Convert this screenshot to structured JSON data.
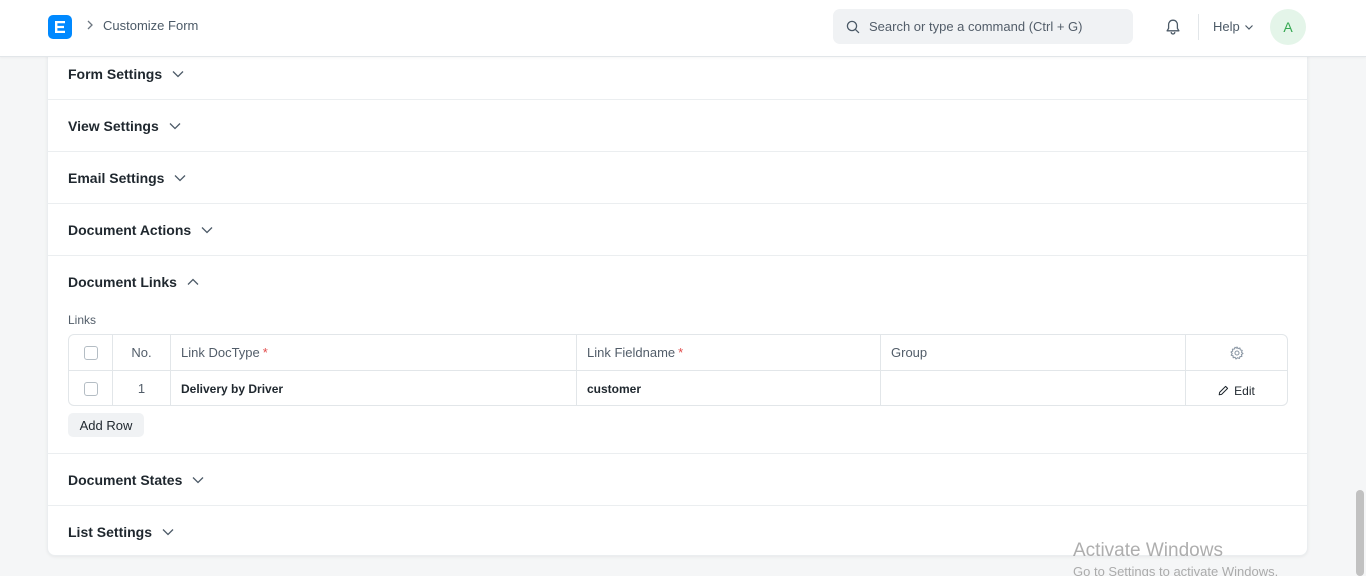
{
  "navbar": {
    "logo_letter": "E",
    "breadcrumb": "Customize Form",
    "search_placeholder": "Search or type a command (Ctrl + G)",
    "help_label": "Help",
    "avatar_initial": "A"
  },
  "sections": {
    "form_settings": "Form Settings",
    "view_settings": "View Settings",
    "email_settings": "Email Settings",
    "document_actions": "Document Actions",
    "document_links": "Document Links",
    "document_states": "Document States",
    "list_settings": "List Settings"
  },
  "links": {
    "label": "Links",
    "columns": {
      "no": "No.",
      "link_doctype": "Link DocType",
      "link_fieldname": "Link Fieldname",
      "group": "Group"
    },
    "required_mark": "*",
    "rows": [
      {
        "no": "1",
        "link_doctype": "Delivery by Driver",
        "link_fieldname": "customer",
        "group": ""
      }
    ],
    "edit_label": "Edit",
    "add_row_label": "Add Row"
  },
  "watermark": {
    "line1": "Activate Windows",
    "line2": "Go to Settings to activate Windows."
  },
  "colors": {
    "brand": "#0089ff",
    "required": "#e24c4c",
    "avatar_bg": "#e4f5e9",
    "avatar_fg": "#36a852"
  }
}
